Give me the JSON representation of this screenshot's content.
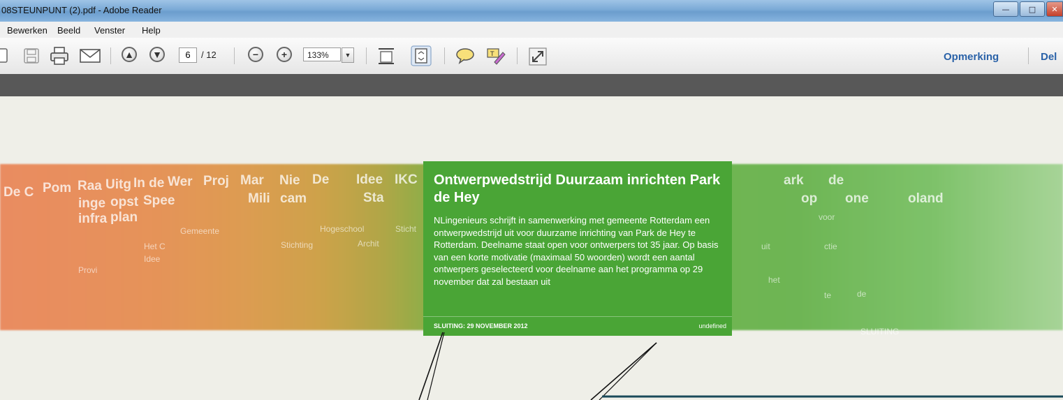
{
  "window": {
    "title": "08STEUNPUNT (2).pdf - Adobe Reader",
    "buttons": {
      "minimize": "—",
      "maximize": "□",
      "close": "✕"
    }
  },
  "menu": [
    "Bewerken",
    "Beeld",
    "Venster",
    "Help"
  ],
  "toolbar": {
    "page_current": "6",
    "page_total": "/ 12",
    "zoom": "133%",
    "comment_link": "Opmerking",
    "share_link": "Del"
  },
  "card": {
    "title": "Ontwerpwedstrijd Duurzaam inrichten Park de Hey",
    "body": "NLingenieurs schrijft in samenwerking met gemeente Rotterdam een ontwerpwedstrijd uit voor duurzame inrichting van Park de Hey te Rotterdam. Deelname staat open voor ontwerpers tot 35 jaar. Op basis van een korte motivatie (maximaal 50 woorden) wordt een aantal ontwerpers geselecteerd voor deelname aan het programma op 29 november dat zal bestaan uit",
    "deadline": "SLUITING: 29 NOVEMBER 2012",
    "tag": "undefined"
  },
  "ghost_titles": [
    "De C",
    "Pom",
    "Raa",
    "Uitg",
    "In de",
    "Wer",
    "Proj",
    "Mar",
    "Nie",
    "De",
    "Idee",
    "IKC",
    "ark",
    "de",
    "oland"
  ],
  "ghost_lines": [
    "inge",
    "opst",
    "Spee",
    "Mili",
    "cam",
    "Sta",
    "infra",
    "plan",
    "op",
    "one"
  ],
  "ghost_small": [
    "Gemeente",
    "Hogeschool",
    "Sticht",
    "Archit",
    "Stichting",
    "Het C",
    "Idee",
    "Provi",
    "voor",
    "uit",
    "ctie",
    "het",
    "te",
    "de",
    "SLUITING"
  ],
  "colors": {
    "card": "#4aa536",
    "link": "#2a62a8",
    "dark_strip": "#585858"
  }
}
